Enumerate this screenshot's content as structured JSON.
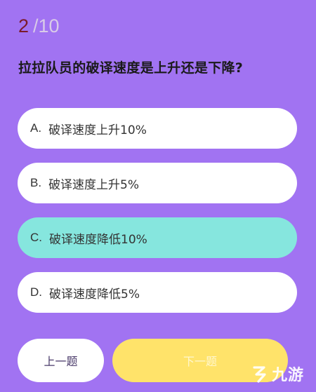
{
  "progress": {
    "current": "2",
    "total": "/10"
  },
  "question": "拉拉队员的破译速度是上升还是下降?",
  "options": [
    {
      "letter": "A.",
      "text": "破译速度上升10%",
      "selected": false
    },
    {
      "letter": "B.",
      "text": "破译速度上升5%",
      "selected": false
    },
    {
      "letter": "C.",
      "text": "破译速度降低10%",
      "selected": true
    },
    {
      "letter": "D.",
      "text": "破译速度降低5%",
      "selected": false
    }
  ],
  "navigation": {
    "prev_label": "上一题",
    "next_label": "下一题"
  },
  "watermark": {
    "text": "九游",
    "icon": "jiuyou-logo-icon"
  },
  "colors": {
    "background": "#a173f2",
    "selected_option": "#86e6de",
    "next_button": "#ffe36a"
  }
}
